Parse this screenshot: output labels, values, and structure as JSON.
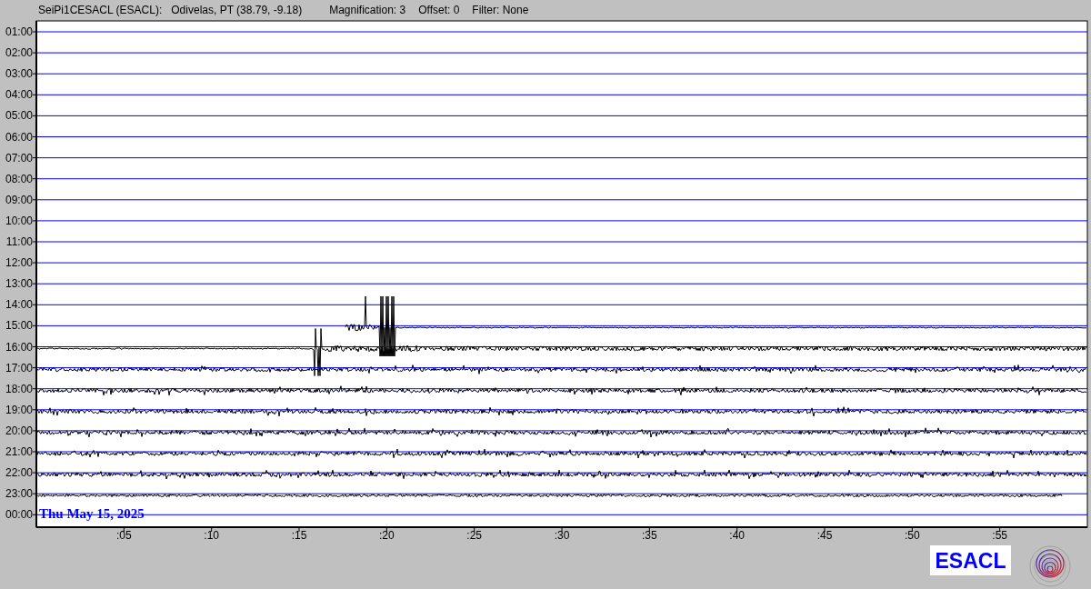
{
  "header": {
    "station": "SeiPi1CESACL (ESACL):",
    "location": "Odivelas, PT (38.79, -9.18)",
    "settings": [
      "Magnification: 3",
      "Offset: 0",
      "Filter: None"
    ]
  },
  "hours": [
    {
      "label": "01:00",
      "trace": false
    },
    {
      "label": "02:00",
      "trace": false
    },
    {
      "label": "03:00",
      "trace": false
    },
    {
      "label": "04:00",
      "trace": false
    },
    {
      "label": "05:00",
      "trace": false
    },
    {
      "label": "06:00",
      "trace": false
    },
    {
      "label": "07:00",
      "trace": false
    },
    {
      "label": "08:00",
      "trace": false
    },
    {
      "label": "09:00",
      "trace": false
    },
    {
      "label": "10:00",
      "trace": false
    },
    {
      "label": "11:00",
      "trace": false
    },
    {
      "label": "12:00",
      "trace": false
    },
    {
      "label": "13:00",
      "trace": false
    },
    {
      "label": "14:00",
      "trace": false
    },
    {
      "label": "15:00",
      "trace": true
    },
    {
      "label": "16:00",
      "trace": true
    },
    {
      "label": "17:00",
      "trace": true
    },
    {
      "label": "18:00",
      "trace": true
    },
    {
      "label": "19:00",
      "trace": true
    },
    {
      "label": "20:00",
      "trace": true
    },
    {
      "label": "21:00",
      "trace": true
    },
    {
      "label": "22:00",
      "trace": true
    },
    {
      "label": "23:00",
      "trace": true
    },
    {
      "label": "00:00",
      "trace": false
    }
  ],
  "minutes": [
    ":05",
    ":10",
    ":15",
    ":20",
    ":25",
    ":30",
    ":35",
    ":40",
    ":45",
    ":50",
    ":55"
  ],
  "date": "Thu May 15, 2025",
  "logo": "ESACL"
}
